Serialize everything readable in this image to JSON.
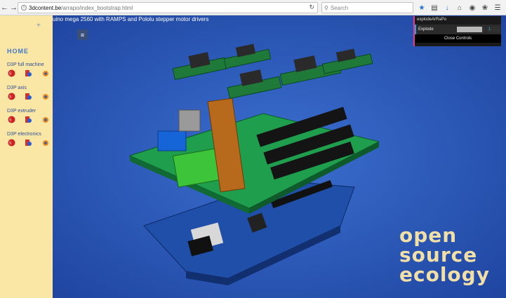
{
  "browser": {
    "url_domain": "3dcontent.be",
    "url_path": "/arrapo/index_bootstrap.html",
    "search_placeholder": "Search"
  },
  "sidebar": {
    "plus": "+",
    "home": "HOME",
    "sections": [
      {
        "label": "D3P full machine"
      },
      {
        "label": "D3P axis"
      },
      {
        "label": "D3P extruder"
      },
      {
        "label": "D3P electronics"
      }
    ]
  },
  "page": {
    "title": "uino mega 2560 with RAMPS and Pololu stepper motor drivers",
    "menu_icon": "≡"
  },
  "controls": {
    "folder": "explodeArRaPo",
    "explode_label": "Explode",
    "explode_value": "1",
    "explode_fraction": 0.9,
    "close_label": "Close Controls"
  },
  "logo": {
    "line1": "open",
    "line2": "source",
    "line3": "ecology"
  },
  "colors": {
    "background": "#2a56b8",
    "sidebar": "#fbe7a5",
    "panel_accent": "#e83a8a",
    "slider_accent": "#2fa1d6"
  }
}
